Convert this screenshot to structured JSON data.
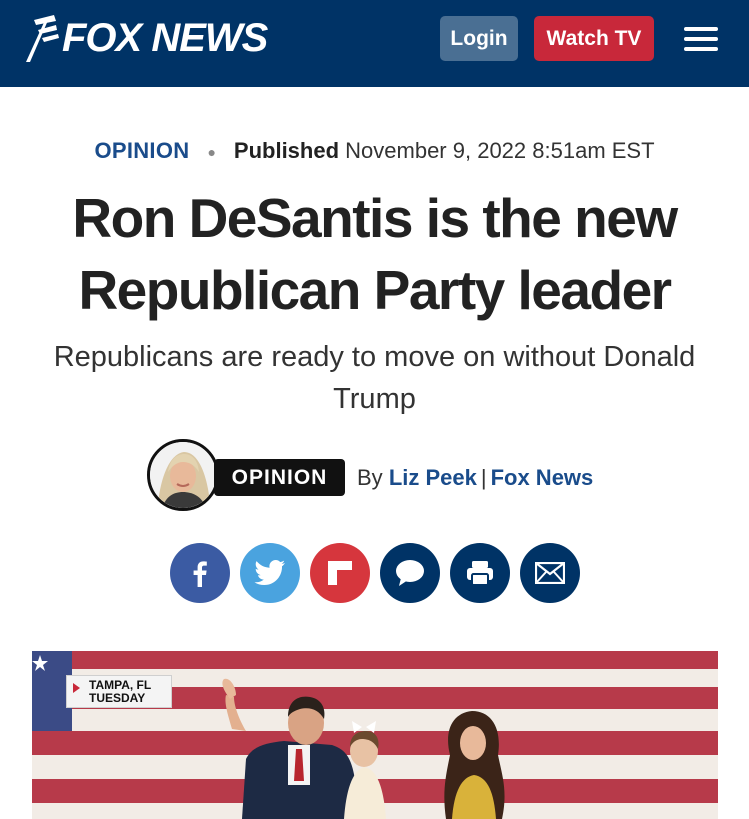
{
  "header": {
    "logo_text": "FOX NEWS",
    "login_label": "Login",
    "watch_label": "Watch TV"
  },
  "article": {
    "eyebrow": "OPINION",
    "published_label": "Published",
    "published_date": "November 9, 2022 8:51am EST",
    "headline": "Ron DeSantis is the new Republican Party leader",
    "subheadline": "Republicans are ready to move on without Donald Trump",
    "badge": "OPINION",
    "by_label": "By",
    "author": "Liz Peek",
    "outlet": "Fox News"
  },
  "share": {
    "icons": [
      "facebook-icon",
      "twitter-icon",
      "flipboard-icon",
      "comments-icon",
      "print-icon",
      "email-icon"
    ]
  },
  "image": {
    "location": "TAMPA, FL",
    "day": "TUESDAY"
  },
  "colors": {
    "header_bg": "#003366",
    "link_blue": "#1a4c8b",
    "watch_red": "#c8283a",
    "login_bg": "#4a6f93"
  }
}
